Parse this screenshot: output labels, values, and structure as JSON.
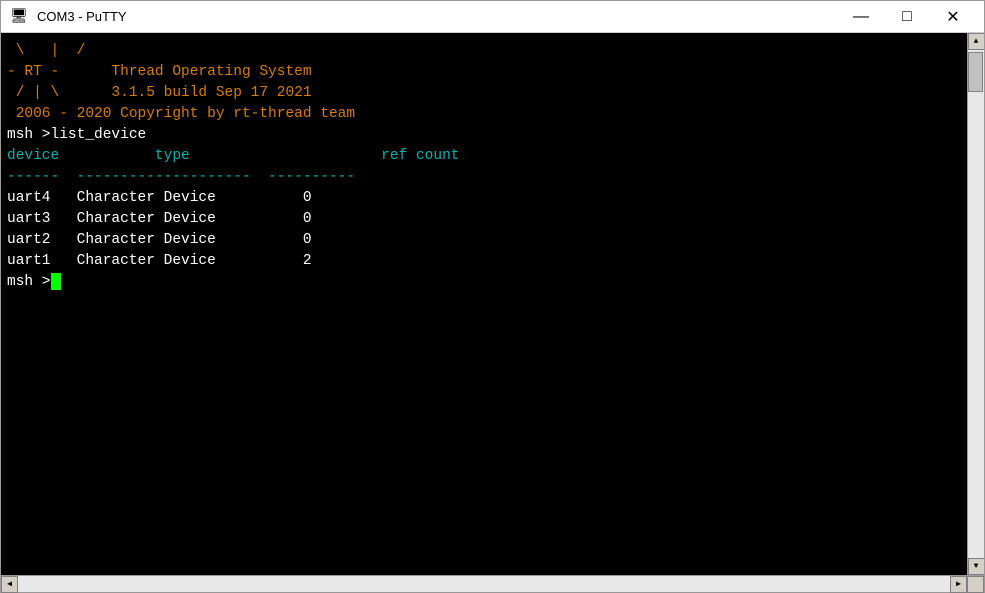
{
  "window": {
    "title": "COM3 - PuTTY",
    "icon": "🖥"
  },
  "titlebar": {
    "minimize_label": "—",
    "maximize_label": "□",
    "close_label": "✕"
  },
  "terminal": {
    "logo_line1": " \\   |  /",
    "logo_line2": "- RT -      Thread Operating System",
    "logo_line3": " / | \\      3.1.5 build Sep 17 2021",
    "logo_line4": " 2006 - 2020 Copyright by rt-thread team",
    "command": "msh >list_device",
    "header_device": "device",
    "header_type": "         type",
    "header_refcount": "          ref count",
    "separator": "------  --------------------  ----------",
    "devices": [
      {
        "name": "uart4",
        "type": "Character Device",
        "refcount": "0"
      },
      {
        "name": "uart3",
        "type": "Character Device",
        "refcount": "0"
      },
      {
        "name": "uart2",
        "type": "Character Device",
        "refcount": "0"
      },
      {
        "name": "uart1",
        "type": "Character Device",
        "refcount": "2"
      }
    ],
    "prompt": "msh >"
  }
}
